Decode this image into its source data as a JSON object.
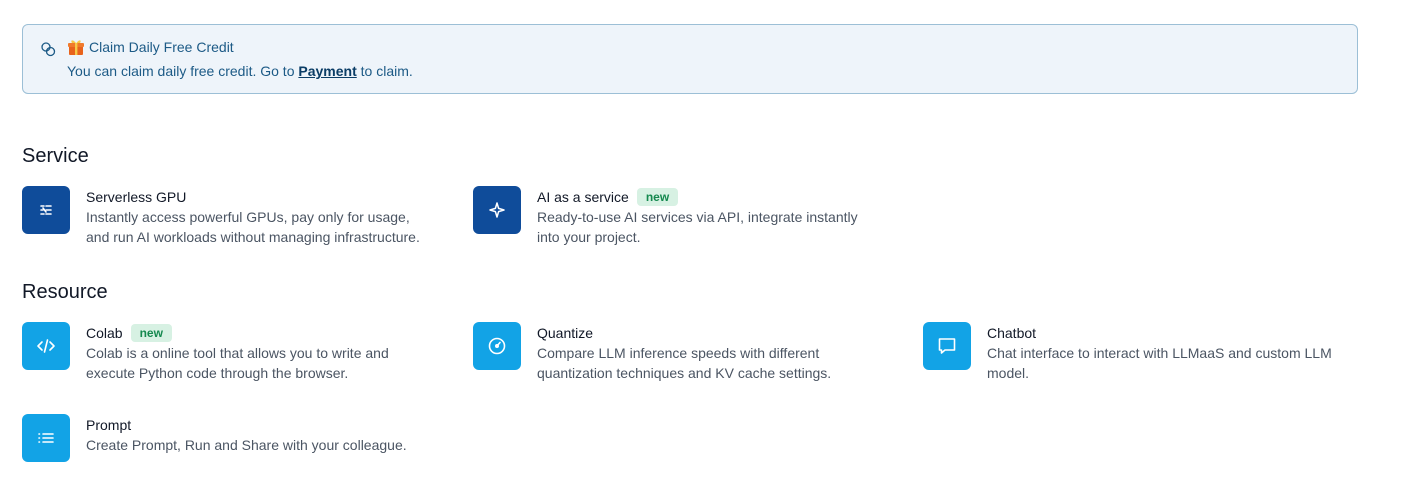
{
  "banner": {
    "title": "Claim Daily Free Credit",
    "text_before": "You can claim daily free credit. Go to",
    "link_label": "Payment",
    "text_after": "to claim."
  },
  "sections": [
    {
      "title": "Service",
      "cards": [
        {
          "title": "Serverless GPU",
          "badge": "",
          "desc_line1": "Instantly access powerful GPUs, pay only for usage,",
          "desc_line2": "and run AI workloads without managing infrastructure.",
          "icon": "serverless-gpu-icon"
        },
        {
          "title": "AI as a service",
          "badge": "new",
          "desc_line1": "Ready-to-use AI services via API, integrate instantly",
          "desc_line2": "into your project.",
          "icon": "sparkle-icon"
        }
      ]
    },
    {
      "title": "Resource",
      "cards": [
        {
          "title": "Colab",
          "badge": "new",
          "desc_line1": "Colab is a online tool that allows you to write and",
          "desc_line2": "execute Python code through the browser.",
          "icon": "code-icon"
        },
        {
          "title": "Quantize",
          "badge": "",
          "desc_line1": "Compare LLM inference speeds with different",
          "desc_line2": "quantization techniques and KV cache settings.",
          "icon": "gauge-icon"
        },
        {
          "title": "Chatbot",
          "badge": "",
          "desc_line1": "Chat interface to interact with LLMaaS and custom LLM",
          "desc_line2": "model.",
          "icon": "chat-bubble-icon"
        },
        {
          "title": "Prompt",
          "badge": "",
          "desc_line1": "Create Prompt, Run and Share with your colleague.",
          "desc_line2": "",
          "icon": "list-icon"
        }
      ]
    }
  ],
  "colors": {
    "banner_bg": "#eef4fa",
    "banner_border": "#9cbfd6",
    "service_icon_bg": "#0f4c9a",
    "resource_icon_bg": "#12a3e6",
    "badge_bg": "#d7f1e3",
    "badge_text": "#15894f"
  }
}
